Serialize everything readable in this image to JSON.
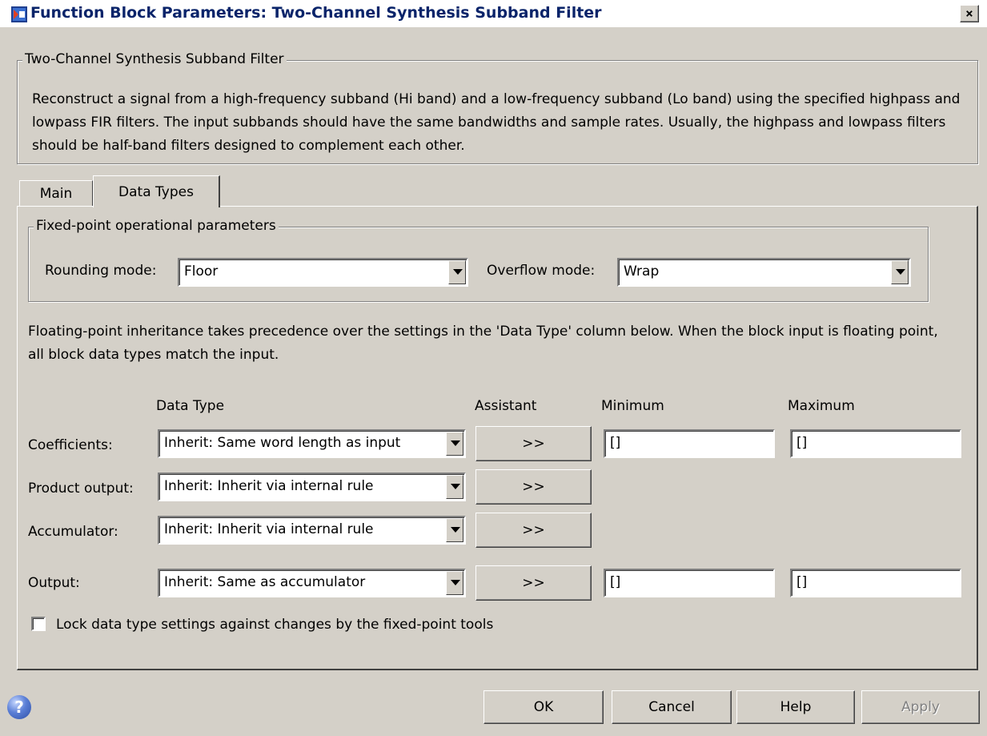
{
  "window": {
    "title": "Function Block Parameters: Two-Channel Synthesis Subband Filter",
    "close_glyph": "×",
    "icon": "simulink-block-icon"
  },
  "description_group": {
    "legend": "Two-Channel Synthesis Subband Filter",
    "text": "Reconstruct a signal from a high-frequency subband (Hi band) and a low-frequency subband (Lo band) using the specified highpass and lowpass FIR filters.  The input subbands should have the same bandwidths and sample rates. Usually, the highpass and lowpass filters should be half-band filters designed to complement each other."
  },
  "tabs": [
    {
      "label": "Main",
      "selected": false
    },
    {
      "label": "Data Types",
      "selected": true
    }
  ],
  "fixed_point": {
    "legend": "Fixed-point operational parameters",
    "rounding_label": "Rounding mode:",
    "rounding_value": "Floor",
    "overflow_label": "Overflow mode:",
    "overflow_value": "Wrap"
  },
  "inheritance_note": "Floating-point inheritance takes precedence over the settings in the 'Data Type' column below. When the block input is floating point, all block data types match the input.",
  "table": {
    "headers": {
      "data_type": "Data Type",
      "assistant": "Assistant",
      "minimum": "Minimum",
      "maximum": "Maximum"
    },
    "rows": [
      {
        "label": "Coefficients:",
        "data_type": "Inherit: Same word length as input",
        "assistant": ">>",
        "minimum": "[]",
        "maximum": "[]"
      },
      {
        "label": "Product output:",
        "data_type": "Inherit: Inherit via internal rule",
        "assistant": ">>"
      },
      {
        "label": "Accumulator:",
        "data_type": "Inherit: Inherit via internal rule",
        "assistant": ">>"
      },
      {
        "label": "Output:",
        "data_type": "Inherit: Same as accumulator",
        "assistant": ">>",
        "minimum": "[]",
        "maximum": "[]"
      }
    ]
  },
  "lock_checkbox": {
    "label": "Lock data type settings against changes by the fixed-point tools",
    "checked": false
  },
  "buttons": {
    "ok": "OK",
    "cancel": "Cancel",
    "help": "Help",
    "apply": "Apply",
    "help_icon_glyph": "?"
  }
}
